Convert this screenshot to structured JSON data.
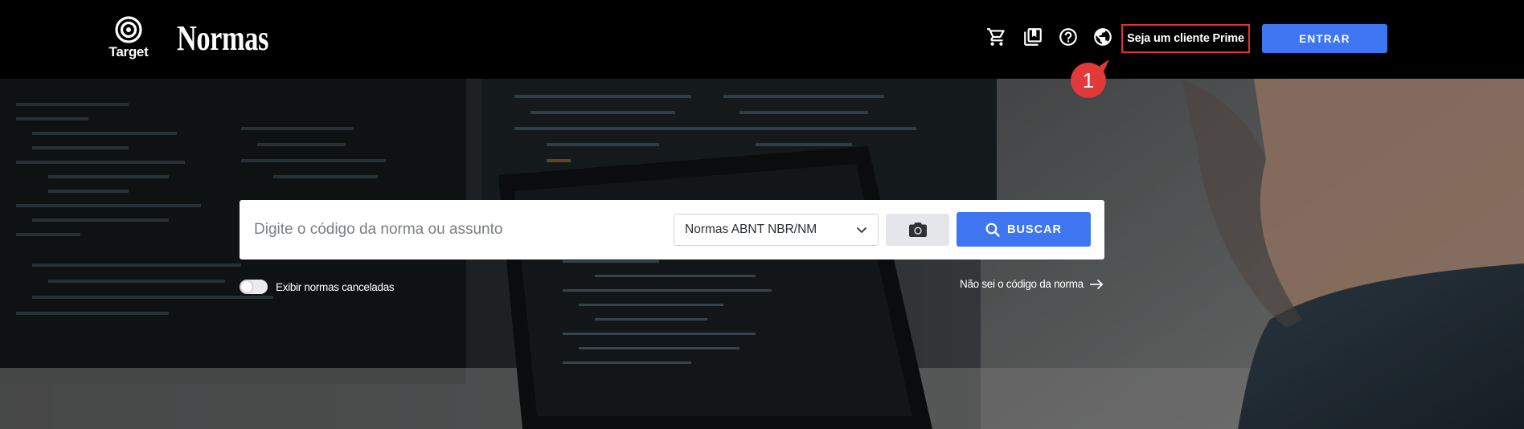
{
  "header": {
    "logo_target_text": "Target",
    "logo_normas_text": "Normas",
    "icons": [
      "cart-icon",
      "book-collection-icon",
      "help-icon",
      "globe-icon"
    ],
    "prime_link": "Seja um cliente Prime",
    "enter_button": "ENTRAR",
    "annotation_number": "1"
  },
  "search": {
    "placeholder": "Digite o código da norma ou assunto",
    "value": "",
    "select_value": "Normas ABNT NBR/NM",
    "camera_icon": "camera-icon",
    "search_button": "BUSCAR",
    "search_icon": "search-icon"
  },
  "options": {
    "toggle_label": "Exibir normas canceladas",
    "toggle_on": false,
    "unknown_code_link": "Não sei o código da norma"
  },
  "colors": {
    "header_bg": "#000000",
    "accent": "#3e76f2",
    "annotation": "#e03131"
  }
}
